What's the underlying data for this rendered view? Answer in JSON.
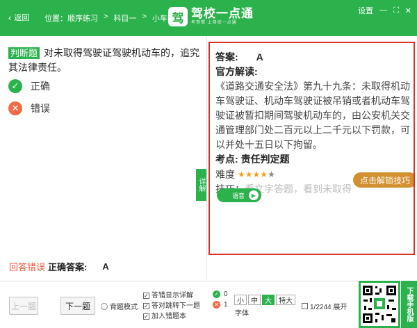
{
  "header": {
    "back_label": "返回",
    "breadcrumb": [
      "位置：顺序练习",
      ">",
      "科目一",
      ">",
      "小车类"
    ],
    "logo_mark": "驾",
    "logo_name": "驾校一点通",
    "logo_slogan": "考驾照  上驾校一点通",
    "settings_label": "设置",
    "controls": [
      "—",
      "⛶",
      "✕"
    ]
  },
  "question": {
    "type": "判断题",
    "text": "对未取得驾驶证驾驶机动车的，追究其法律责任。",
    "options": [
      {
        "icon": "✓",
        "label": "正确"
      },
      {
        "icon": "✕",
        "label": "错误"
      }
    ]
  },
  "result": {
    "wrong_label": "回答错误",
    "correct_label": "正确答案:",
    "correct_value": "A"
  },
  "detail_tab": "详解",
  "analysis": {
    "answer_label": "答案:",
    "answer_value": "A",
    "official_label": "官方解读:",
    "official_text": "《道路交通安全法》第九十九条：未取得机动车驾驶证、机动车驾驶证被吊销或者机动车驾驶证被暂扣期间驾驶机动车的，由公安机关交通管理部门处二百元以上二千元以下罚款，可以并处十五日以下拘留。",
    "point_label": "考点:",
    "point_value": "责任判定题",
    "difficulty_label": "难度",
    "difficulty_stars": 4,
    "difficulty_max": 5,
    "tip_label": "技巧：",
    "tip_text": "看文字答题，看到未取得",
    "unlock_label": "点击解锁技巧",
    "voice_label": "语音"
  },
  "footer": {
    "prev_label": "上一题",
    "next_label": "下一题",
    "recite_label": "背题模式",
    "checkboxes": [
      {
        "label": "答错显示详解",
        "checked": true
      },
      {
        "label": "答对跳转下一题",
        "checked": true
      },
      {
        "label": "加入错题本",
        "checked": true
      }
    ],
    "correct_count": "0",
    "wrong_count": "1",
    "font_sizes": [
      "小",
      "中",
      "大",
      "特大"
    ],
    "font_active": "大",
    "font_label": "字体",
    "pager_text": "1/2244 展开",
    "qr_label": "下载手机版"
  },
  "colors": {
    "brand": "#2bb24c",
    "error": "#ef6c4a",
    "highlight_border": "#d9302a",
    "unlock": "#d3902f",
    "star": "#f0a020"
  }
}
